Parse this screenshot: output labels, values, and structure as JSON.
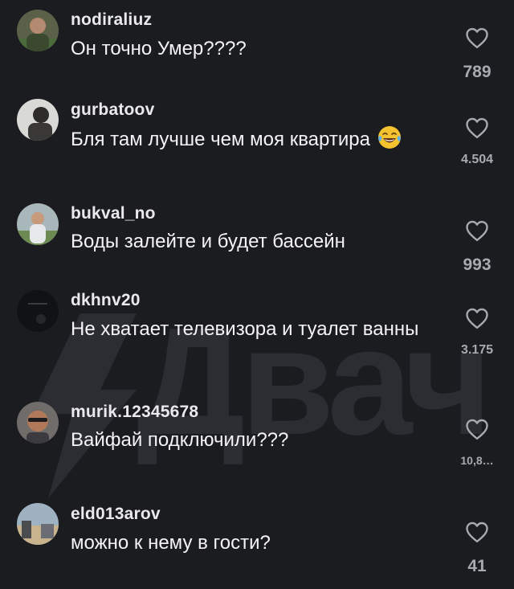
{
  "watermark": {
    "text": "Двач"
  },
  "comments": [
    {
      "username": "nodiraliuz",
      "text": "Он точно Умер????",
      "likes": "789",
      "avatar_color": "#4f5a3e"
    },
    {
      "username": "gurbatoov",
      "text": "Бля там лучше чем моя квартира",
      "emoji": "😂",
      "likes": "4.504",
      "avatar_color": "#7a7d80"
    },
    {
      "username": "bukval_no",
      "text": "Воды залейте и будет бассейн",
      "likes": "993",
      "avatar_color": "#8fa0a8"
    },
    {
      "username": "dkhnv20",
      "text": "Не хватает телевизора и туалет ванны",
      "likes": "3.175",
      "avatar_color": "#15161a"
    },
    {
      "username": "murik.12345678",
      "text": "Вайфай подключили???",
      "likes": "10,8…",
      "avatar_color": "#8a5f48"
    },
    {
      "username": "eld013arov",
      "text": "можно к нему в гости?",
      "likes": "41",
      "avatar_color": "#7895ad"
    }
  ],
  "colors": {
    "background": "#1b1c20",
    "text": "#f4f4f6",
    "muted": "#a9aab1",
    "watermark": "#2c2d33"
  },
  "icons": {
    "like": "heart-outline-icon"
  }
}
